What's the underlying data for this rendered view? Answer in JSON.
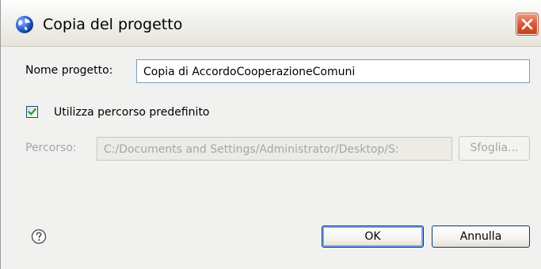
{
  "window": {
    "title": "Copia del progetto",
    "icons": {
      "app": "globe-icon",
      "close": "close-icon"
    }
  },
  "form": {
    "project_name_label": "Nome progetto:",
    "project_name_value": "Copia di AccordoCooperazioneComuni",
    "use_default_label": "Utilizza percorso predefinito",
    "use_default_checked": true,
    "path_label": "Percorso:",
    "path_value": "C:/Documents and Settings/Administrator/Desktop/S:",
    "browse_label": "Sfoglia..."
  },
  "footer": {
    "help_icon": "help-icon",
    "ok_label": "OK",
    "cancel_label": "Annulla"
  },
  "colors": {
    "accent": "#7fa4ee",
    "close": "#d9583a",
    "disabled_text": "#a6a6a6"
  }
}
